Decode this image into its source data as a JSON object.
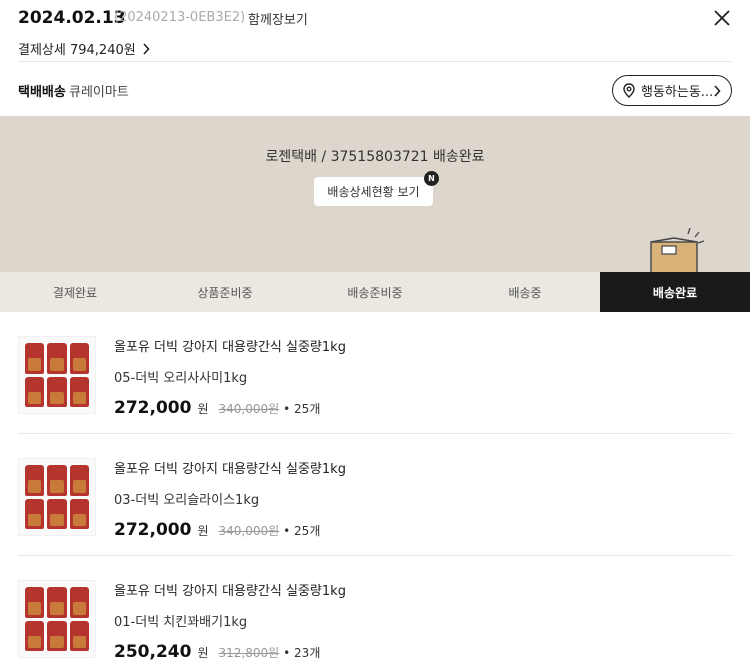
{
  "header": {
    "order_date": "2024.02.13",
    "order_id": "(20240213-0EB3E2)",
    "together_label": "함께장보기",
    "payment_detail": "결제상세 794,240원"
  },
  "shipping": {
    "type": "택배배송",
    "vendor": "큐레이마트",
    "action_label": "행동하는동..."
  },
  "status": {
    "carrier_line": "로젠택배 / 37515803721 배송완료",
    "detail_button": "배송상세현황 보기",
    "new_badge": "N",
    "steps": [
      "결제완료",
      "상품준비중",
      "배송준비중",
      "배송중",
      "배송완료"
    ],
    "active_step": 4
  },
  "items": [
    {
      "name": "올포유 더빅 강아지 대용량간식 실중량1kg",
      "option": "05-더빅 오리사사미1kg",
      "price": "272,000",
      "currency": "원",
      "original_price": "340,000원",
      "quantity": "• 25개"
    },
    {
      "name": "올포유 더빅 강아지 대용량간식 실중량1kg",
      "option": "03-더빅 오리슬라이스1kg",
      "price": "272,000",
      "currency": "원",
      "original_price": "340,000원",
      "quantity": "• 25개"
    },
    {
      "name": "올포유 더빅 강아지 대용량간식 실중량1kg",
      "option": "01-더빅 치킨꽈배기1kg",
      "price": "250,240",
      "currency": "원",
      "original_price": "312,800원",
      "quantity": "• 23개"
    }
  ],
  "colors": {
    "status_bg": "#dcd6cc",
    "active_step_bg": "#1a1a1a",
    "pouch_red": "#b5342e"
  }
}
